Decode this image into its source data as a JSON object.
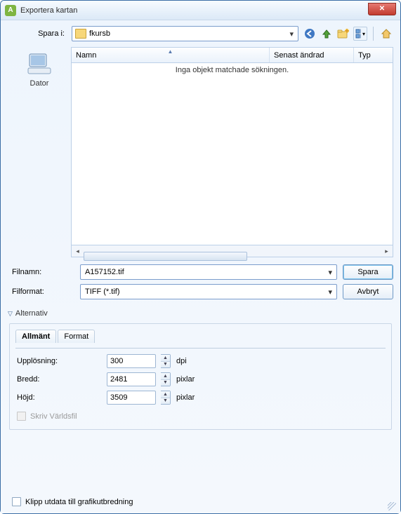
{
  "window": {
    "title": "Exportera kartan",
    "icon_letter": "A"
  },
  "save_in": {
    "label": "Spara i:",
    "folder": "fkursb"
  },
  "toolbar_icons": {
    "back": "back-icon",
    "up": "up-icon",
    "newfolder": "new-folder-icon",
    "viewmenu": "view-menu-icon",
    "home": "home-icon"
  },
  "places": {
    "computer_label": "Dator"
  },
  "columns": {
    "name": "Namn",
    "modified": "Senast ändrad",
    "type": "Typ"
  },
  "file_area": {
    "empty_message": "Inga objekt matchade sökningen."
  },
  "filename": {
    "label": "Filnamn:",
    "value": "A157152.tif"
  },
  "fileformat": {
    "label": "Filformat:",
    "value": "TIFF (*.tif)"
  },
  "buttons": {
    "save": "Spara",
    "cancel": "Avbryt"
  },
  "alternatives": {
    "toggle_label": "Alternativ"
  },
  "tabs": {
    "general": "Allmänt",
    "format": "Format"
  },
  "options": {
    "resolution_label": "Upplösning:",
    "resolution_value": "300",
    "resolution_unit": "dpi",
    "width_label": "Bredd:",
    "width_value": "2481",
    "width_unit": "pixlar",
    "height_label": "Höjd:",
    "height_value": "3509",
    "height_unit": "pixlar",
    "worldfile_label": "Skriv Världsfil"
  },
  "clip": {
    "label": "Klipp utdata till grafikutbredning"
  }
}
